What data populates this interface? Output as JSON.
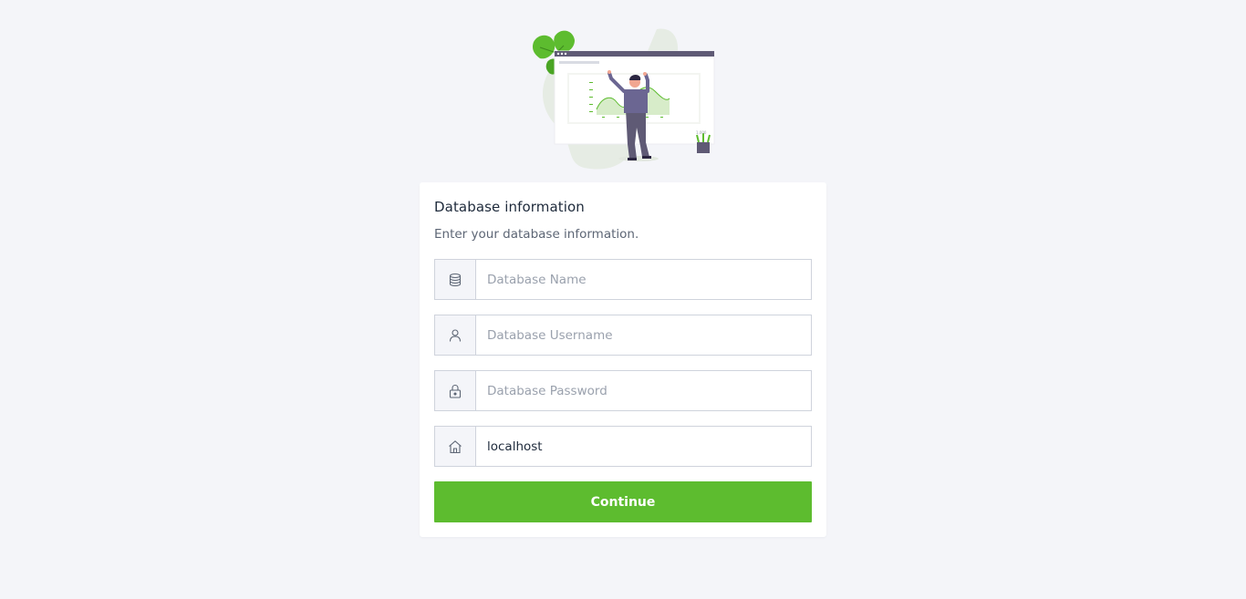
{
  "colors": {
    "accent": "#5dbc2f",
    "background": "#f4f5f9",
    "card": "#ffffff",
    "title_text": "#1e2a3b",
    "muted_text": "#5d6675",
    "border": "#cfd3dc"
  },
  "illustration": {
    "icon": "analytics-illustration",
    "board_label": "1,000"
  },
  "form": {
    "title": "Database information",
    "subtitle": "Enter your database information.",
    "fields": [
      {
        "icon": "database-icon",
        "placeholder": "Database Name",
        "value": ""
      },
      {
        "icon": "user-icon",
        "placeholder": "Database Username",
        "value": ""
      },
      {
        "icon": "lock-icon",
        "placeholder": "Database Password",
        "value": ""
      },
      {
        "icon": "home-icon",
        "placeholder": "",
        "value": "localhost"
      }
    ],
    "submit_label": "Continue"
  }
}
